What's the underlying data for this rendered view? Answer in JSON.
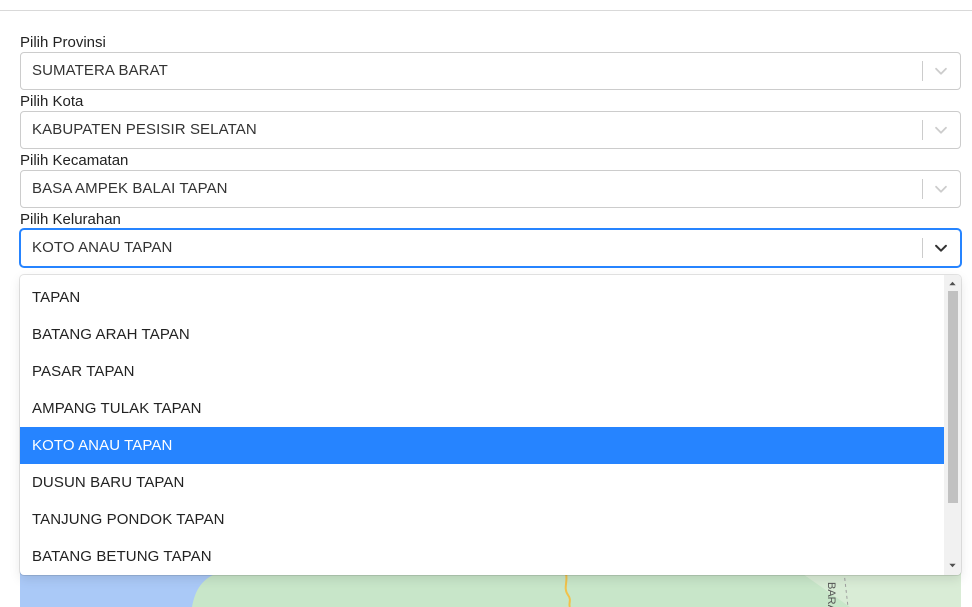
{
  "form": {
    "provinsi": {
      "label": "Pilih Provinsi",
      "value": "SUMATERA BARAT"
    },
    "kota": {
      "label": "Pilih Kota",
      "value": "KABUPATEN PESISIR SELATAN"
    },
    "kecamatan": {
      "label": "Pilih Kecamatan",
      "value": "BASA AMPEK BALAI TAPAN"
    },
    "kelurahan": {
      "label": "Pilih Kelurahan",
      "value": "KOTO ANAU TAPAN"
    }
  },
  "dropdown": {
    "options": [
      "TAPAN",
      "BATANG ARAH TAPAN",
      "PASAR TAPAN",
      "AMPANG TULAK TAPAN",
      "KOTO ANAU TAPAN",
      "DUSUN BARU TAPAN",
      "TANJUNG PONDOK TAPAN",
      "BATANG BETUNG TAPAN"
    ],
    "selected_index": 4,
    "selected_color": "#2684ff"
  },
  "map": {
    "fragment_label": "BARAT",
    "water_color": "#aac9f7",
    "land_color": "#c8e6c9"
  },
  "icons": {
    "select_indicator": "chevron-down-icon",
    "scroll_up": "triangle-up-icon",
    "scroll_down": "triangle-down-icon"
  }
}
